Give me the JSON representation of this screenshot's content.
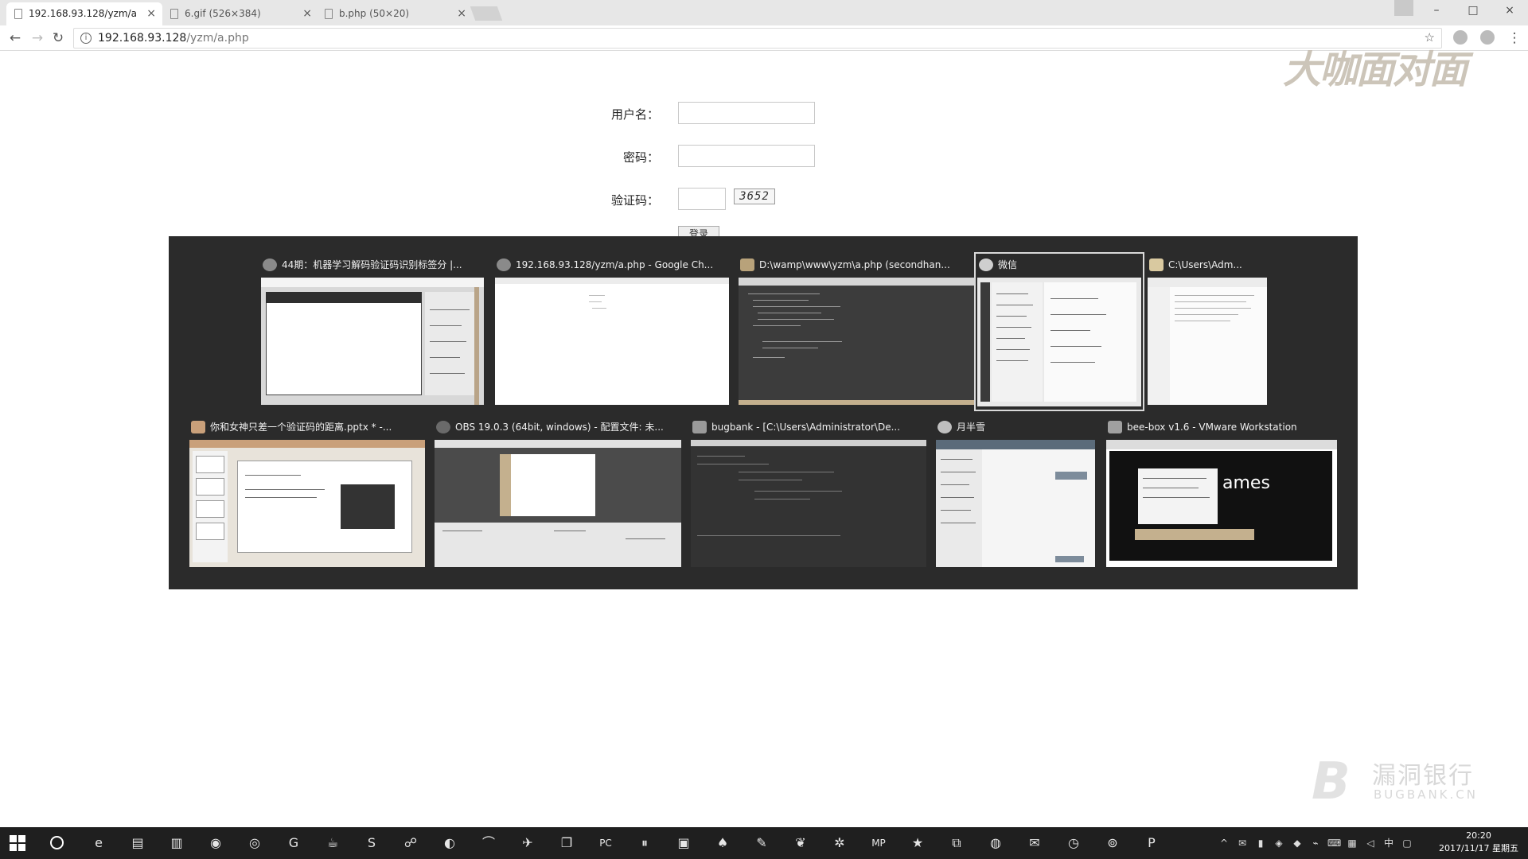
{
  "browser": {
    "tabs": [
      {
        "title": "192.168.93.128/yzm/a",
        "active": true
      },
      {
        "title": "6.gif (526×384)",
        "active": false
      },
      {
        "title": "b.php (50×20)",
        "active": false
      }
    ],
    "close_glyph": "×",
    "url_host": "192.168.93.128",
    "url_path": "/yzm/a.php"
  },
  "form": {
    "username_label": "用户名：",
    "password_label": "密码：",
    "captcha_label": "验证码：",
    "captcha_image_text": "3652",
    "submit_label": "登录"
  },
  "watermark": {
    "top_text": "大咖面对面",
    "bottom_cn": "漏洞银行",
    "bottom_en": "BUGBANK.CN"
  },
  "switcher": {
    "windows": [
      {
        "title": "44期：机器学习解码验证码识别标签分 |...",
        "icon": "chrome-icon",
        "icon_color": "#8a8a8a"
      },
      {
        "title": "192.168.93.128/yzm/a.php - Google Ch...",
        "icon": "chrome-icon",
        "icon_color": "#8a8a8a"
      },
      {
        "title": "D:\\wamp\\www\\yzm\\a.php (secondhan...",
        "icon": "sublime-icon",
        "icon_color": "#b8a27a"
      },
      {
        "title": "微信",
        "icon": "wechat-icon",
        "icon_color": "#cfcfcf",
        "selected": true
      },
      {
        "title": "C:\\Users\\Adm...",
        "icon": "folder-icon",
        "icon_color": "#d9c9a0"
      },
      {
        "title": "你和女神只差一个验证码的距离.pptx * -...",
        "icon": "powerpoint-icon",
        "icon_color": "#c9a07a"
      },
      {
        "title": "OBS 19.0.3 (64bit, windows) - 配置文件: 未...",
        "icon": "obs-icon",
        "icon_color": "#6a6a6a"
      },
      {
        "title": "bugbank - [C:\\Users\\Administrator\\De...",
        "icon": "pycharm-icon",
        "icon_color": "#9a9a9a"
      },
      {
        "title": "月半雪",
        "icon": "chat-icon",
        "icon_color": "#bfbfbf"
      },
      {
        "title": "bee-box v1.6 - VMware Workstation",
        "icon": "vmware-icon",
        "icon_color": "#a0a0a0"
      }
    ],
    "vm_thumbnail_text": "ames"
  },
  "taskbar": {
    "apps": [
      {
        "name": "edge-icon",
        "glyph": "e"
      },
      {
        "name": "file-explorer-icon",
        "glyph": "▤"
      },
      {
        "name": "notepad-icon",
        "glyph": "▥"
      },
      {
        "name": "chrome-icon",
        "glyph": "◉"
      },
      {
        "name": "recorder-icon",
        "glyph": "◎"
      },
      {
        "name": "g-app-icon",
        "glyph": "G"
      },
      {
        "name": "java-icon",
        "glyph": "☕"
      },
      {
        "name": "sublime-icon",
        "glyph": "S"
      },
      {
        "name": "network-icon",
        "glyph": "☍"
      },
      {
        "name": "firefox-icon",
        "glyph": "◐"
      },
      {
        "name": "rainbow-icon",
        "glyph": "⌒"
      },
      {
        "name": "bird-icon",
        "glyph": "✈"
      },
      {
        "name": "windows-icon",
        "glyph": "❐"
      },
      {
        "name": "pycharm-icon",
        "glyph": "PC"
      },
      {
        "name": "obs-pause-icon",
        "glyph": "⏸"
      },
      {
        "name": "monitor-icon",
        "glyph": "▣"
      },
      {
        "name": "rocket-icon",
        "glyph": "♠"
      },
      {
        "name": "edit-icon",
        "glyph": "✎"
      },
      {
        "name": "squirrel-icon",
        "glyph": "❦"
      },
      {
        "name": "bug-icon",
        "glyph": "✲"
      },
      {
        "name": "mp-icon",
        "glyph": "MP"
      },
      {
        "name": "star-icon",
        "glyph": "★"
      },
      {
        "name": "vmware-icon",
        "glyph": "⧉"
      },
      {
        "name": "power-icon",
        "glyph": "◍"
      },
      {
        "name": "wechat-icon",
        "glyph": "✉"
      },
      {
        "name": "clock-app-icon",
        "glyph": "◷"
      },
      {
        "name": "obs-icon",
        "glyph": "⊚"
      },
      {
        "name": "powerpoint-icon",
        "glyph": "P"
      }
    ],
    "tray": [
      {
        "name": "chevron-up-icon",
        "glyph": "^"
      },
      {
        "name": "wechat-tray-icon",
        "glyph": "✉"
      },
      {
        "name": "battery-icon",
        "glyph": "▮"
      },
      {
        "name": "shield-icon",
        "glyph": "◈"
      },
      {
        "name": "shield-check-icon",
        "glyph": "◆"
      },
      {
        "name": "usb-icon",
        "glyph": "⌁"
      },
      {
        "name": "keyboard-icon",
        "glyph": "⌨"
      },
      {
        "name": "network-tray-icon",
        "glyph": "▦"
      },
      {
        "name": "volume-icon",
        "glyph": "◁"
      },
      {
        "name": "ime-icon",
        "glyph": "中"
      },
      {
        "name": "notification-icon",
        "glyph": "▢"
      }
    ],
    "time": "20:20",
    "date": "2017/11/17 星期五"
  }
}
